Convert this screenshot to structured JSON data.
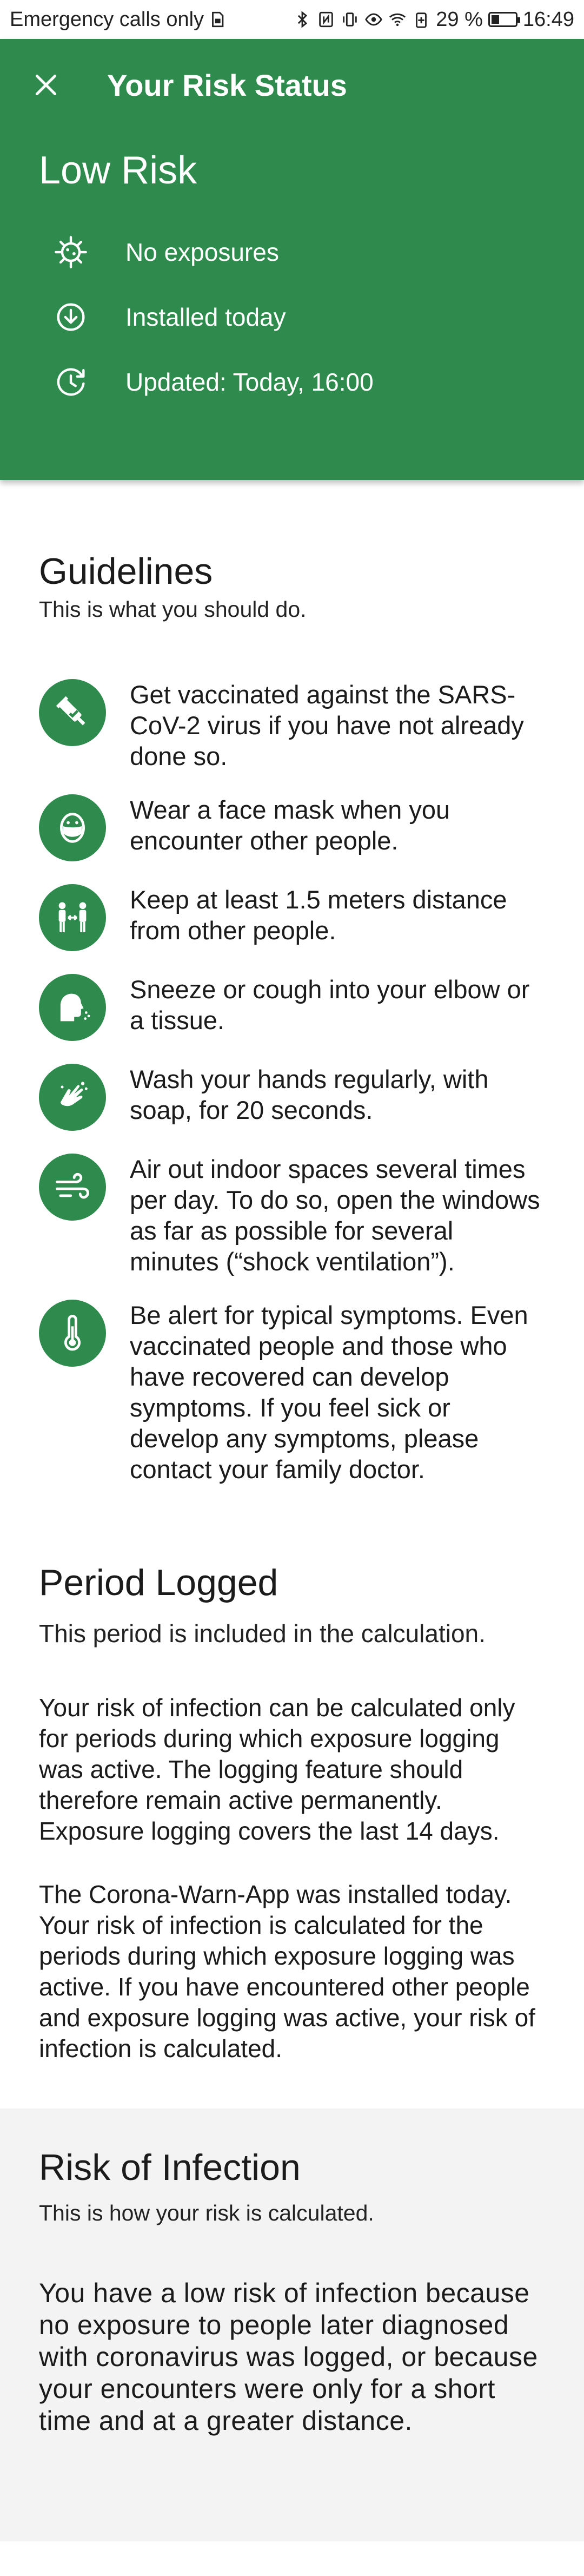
{
  "status_bar": {
    "carrier": "Emergency calls only",
    "battery_percent": "29 %",
    "time": "16:49"
  },
  "header": {
    "title": "Your Risk Status",
    "risk_level": "Low Risk",
    "details": [
      {
        "icon": "virus-icon",
        "text": "No exposures"
      },
      {
        "icon": "download-icon",
        "text": "Installed today"
      },
      {
        "icon": "clock-icon",
        "text": "Updated: Today, 16:00"
      }
    ]
  },
  "guidelines": {
    "title": "Guidelines",
    "subtitle": "This is what you should do.",
    "items": [
      {
        "icon": "vaccine-icon",
        "text": "Get vaccinated against the SARS-CoV-2 virus if you have not already done so."
      },
      {
        "icon": "face-mask-icon",
        "text": "Wear a face mask when you encounter other people."
      },
      {
        "icon": "distance-icon",
        "text": "Keep at least 1.5 meters distance from other people."
      },
      {
        "icon": "sneeze-icon",
        "text": "Sneeze or cough into your elbow or a tissue."
      },
      {
        "icon": "hand-wash-icon",
        "text": "Wash your hands regularly, with soap, for 20 seconds."
      },
      {
        "icon": "ventilation-icon",
        "text": "Air out indoor spaces several times per day. To do so, open the windows as far as possible for several minutes (“shock ventilation”)."
      },
      {
        "icon": "thermometer-icon",
        "text": "Be alert for typical symptoms. Even vaccinated people and those who have recovered can develop symptoms. If you feel sick or develop any symptoms, please contact your family doctor."
      }
    ]
  },
  "period": {
    "title": "Period Logged",
    "subtitle": "This period is included in the calculation.",
    "paragraphs": [
      "Your risk of infection can be calculated only for periods during which exposure logging was active. The logging feature should therefore remain active permanently. Exposure logging covers the last 14 days.",
      "The Corona-Warn-App was installed today. Your risk of infection is calculated for the periods during which exposure logging was active. If you have encountered other people and exposure logging was active, your risk of infection is calculated."
    ]
  },
  "infection": {
    "title": "Risk of Infection",
    "subtitle": "This is how your risk is calculated.",
    "paragraph": "You have a low risk of infection because no exposure to people later diagnosed with coronavirus was logged, or because your encounters were only for a short time and at a greater distance."
  },
  "colors": {
    "accent_green": "#2e8b4d",
    "section_gray": "#f3f3f3"
  }
}
